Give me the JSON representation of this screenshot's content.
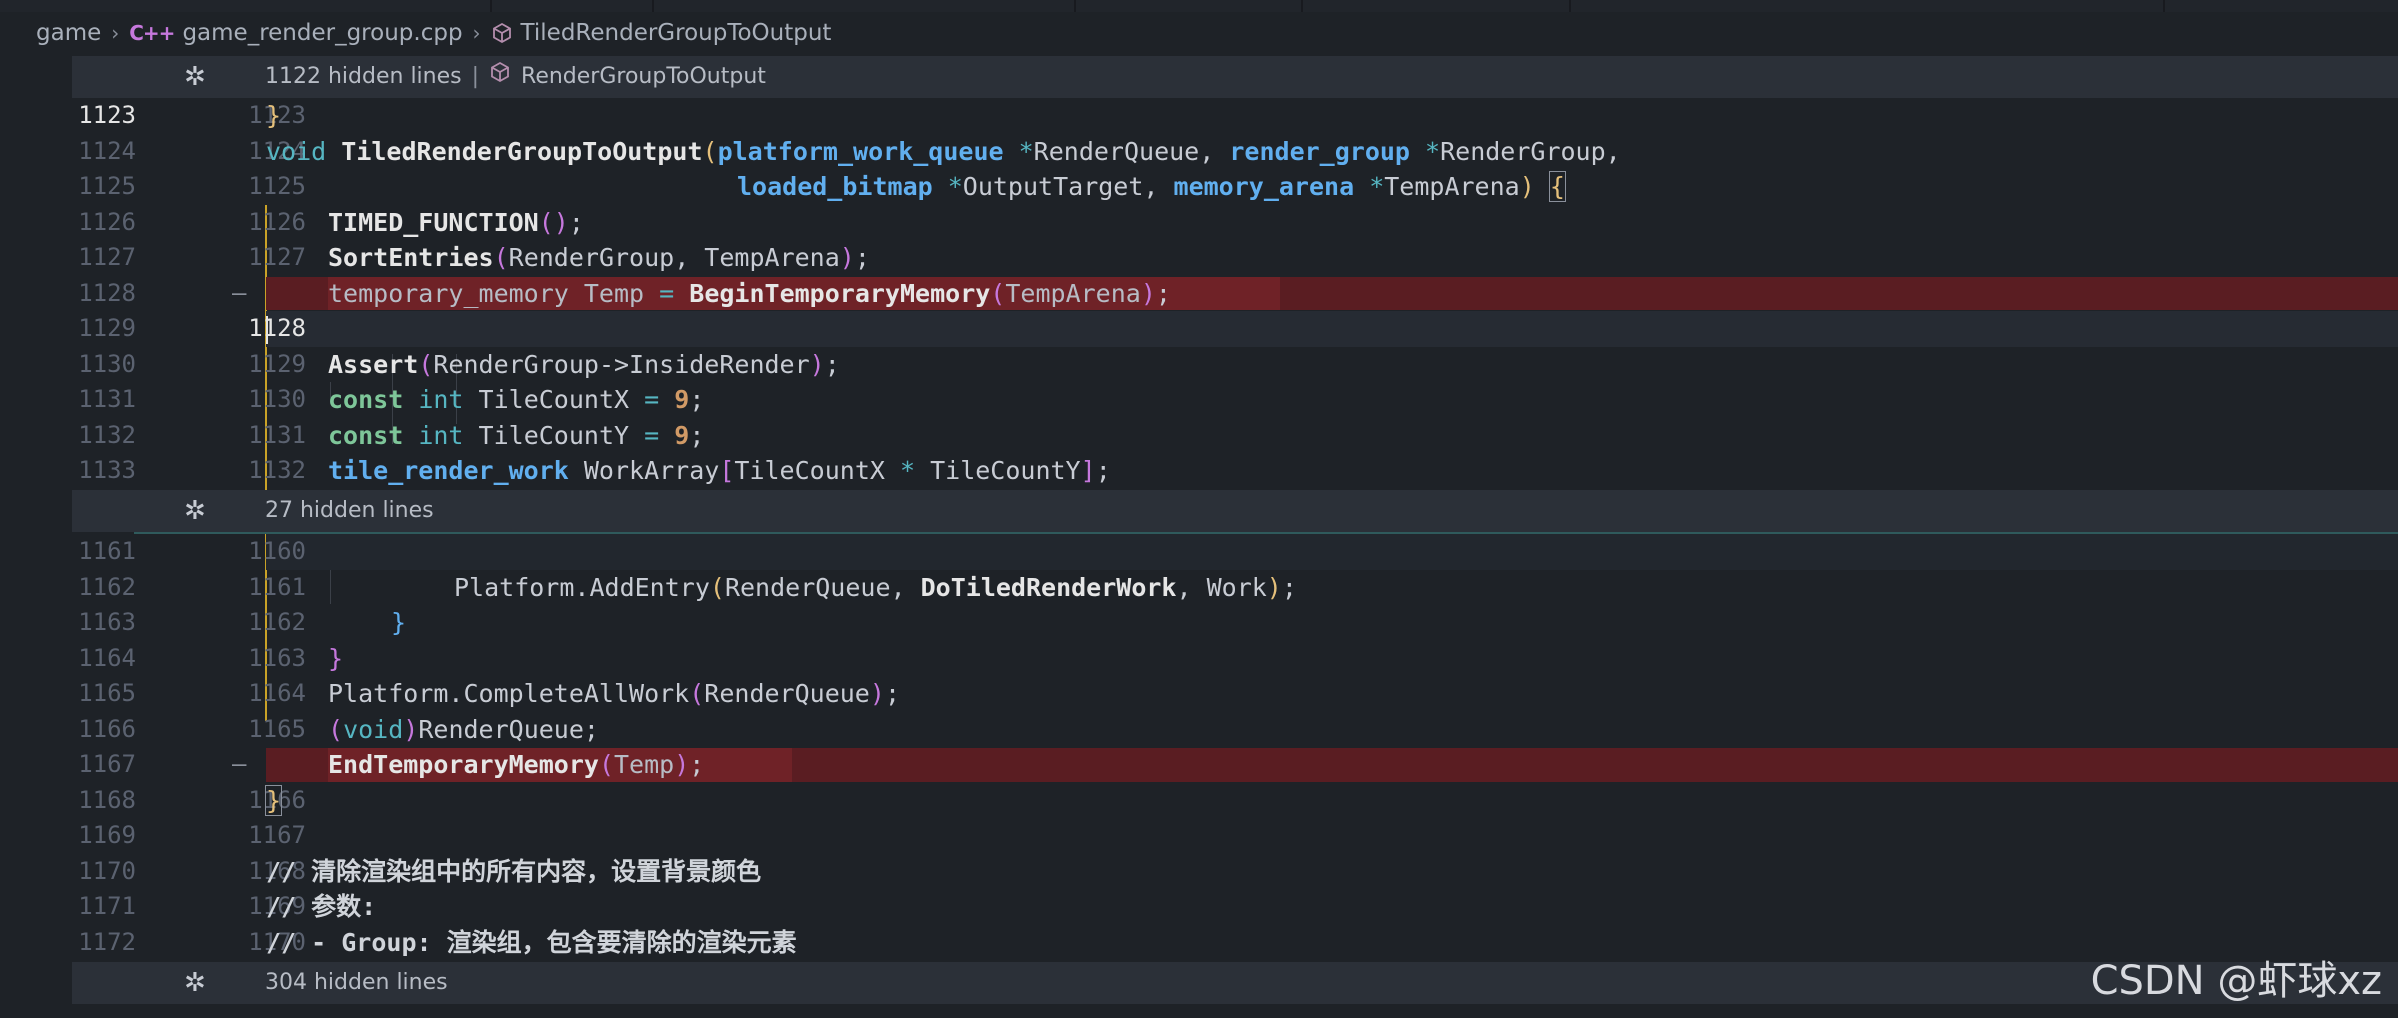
{
  "breadcrumb": {
    "folder": "game",
    "file": "game_render_group.cpp",
    "file_icon_text": "C++",
    "symbol": "TiledRenderGroupToOutput"
  },
  "fold_bars": [
    {
      "text": "1122 hidden lines",
      "symbol": "RenderGroupToOutput"
    },
    {
      "text": "27 hidden lines"
    },
    {
      "text": "304 hidden lines"
    }
  ],
  "lines": {
    "l1": {
      "a": "1123",
      "b": "1123"
    },
    "l2": {
      "a": "1124",
      "b": "1124"
    },
    "l3": {
      "a": "1125",
      "b": "1125"
    },
    "l4": {
      "a": "1126",
      "b": "1126"
    },
    "l5": {
      "a": "1127",
      "b": "1127"
    },
    "l6": {
      "a": "1128",
      "b": "",
      "marker": "—"
    },
    "l7": {
      "a": "1129",
      "b": "1128"
    },
    "l8": {
      "a": "1130",
      "b": "1129"
    },
    "l9": {
      "a": "1131",
      "b": "1130"
    },
    "l10": {
      "a": "1132",
      "b": "1131"
    },
    "l11": {
      "a": "1133",
      "b": "1132"
    },
    "l12": {
      "a": "1161",
      "b": "1160"
    },
    "l13": {
      "a": "1162",
      "b": "1161"
    },
    "l14": {
      "a": "1163",
      "b": "1162"
    },
    "l15": {
      "a": "1164",
      "b": "1163"
    },
    "l16": {
      "a": "1165",
      "b": "1164"
    },
    "l17": {
      "a": "1166",
      "b": "1165"
    },
    "l18": {
      "a": "1167",
      "b": "",
      "marker": "—"
    },
    "l19": {
      "a": "1168",
      "b": "1166"
    },
    "l20": {
      "a": "1169",
      "b": "1167"
    },
    "l21": {
      "a": "1170",
      "b": "1168"
    },
    "l22": {
      "a": "1171",
      "b": "1169"
    },
    "l23": {
      "a": "1172",
      "b": "1170"
    }
  },
  "code": {
    "l1": {
      "brace": "}"
    },
    "l2": {
      "void": "void",
      "fn": "TiledRenderGroupToOutput",
      "p1": "(",
      "t1": "platform_work_queue",
      "s1": " *",
      "v1": "RenderQueue",
      "c1": ", ",
      "t2": "render_group",
      "s2": " *",
      "v2": "RenderGroup",
      "c2": ","
    },
    "l3": {
      "t1": "loaded_bitmap",
      "s1": " *",
      "v1": "OutputTarget",
      "c1": ", ",
      "t2": "memory_arena",
      "s2": " *",
      "v2": "TempArena",
      "p2": ")",
      "b": "{"
    },
    "l4": {
      "fn": "TIMED_FUNCTION",
      "p": "()",
      "semi": ";"
    },
    "l5": {
      "fn": "SortEntries",
      "p1": "(",
      "args": "RenderGroup, TempArena",
      "p2": ")",
      "semi": ";"
    },
    "l6": {
      "pre": "temporary_memory Temp ",
      "eq": "=",
      "sp": " ",
      "fn": "BeginTemporaryMemory",
      "p1": "(",
      "arg": "TempArena",
      "p2": ")",
      "semi": ";"
    },
    "l8": {
      "fn": "Assert",
      "p1": "(",
      "arg": "RenderGroup->InsideRender",
      "p2": ")",
      "semi": ";"
    },
    "l9": {
      "kw": "const",
      "ty": "int",
      "id": "TileCountX",
      "eq": "=",
      "num": "9",
      "semi": ";"
    },
    "l10": {
      "kw": "const",
      "ty": "int",
      "id": "TileCountY",
      "eq": "=",
      "num": "9",
      "semi": ";"
    },
    "l11": {
      "ty": "tile_render_work",
      "id": " WorkArray",
      "b1": "[",
      "a": "TileCountX ",
      "op": "*",
      "b": " TileCountY",
      "b2": "]",
      "semi": ";"
    },
    "l13": {
      "pre": "Platform.AddEntry",
      "p1": "(",
      "a": "RenderQueue, ",
      "fn": "DoTiledRenderWork",
      "b": ", Work",
      "p2": ")",
      "semi": ";"
    },
    "l14": {
      "brace": "}"
    },
    "l15": {
      "brace": "}"
    },
    "l16": {
      "pre": "Platform.CompleteAllWork",
      "p1": "(",
      "a": "RenderQueue",
      "p2": ")",
      "semi": ";"
    },
    "l17": {
      "p1": "(",
      "kw": "void",
      "p2": ")",
      "a": "RenderQueue;"
    },
    "l18": {
      "fn": "EndTemporaryMemory",
      "p1": "(",
      "arg": "Temp",
      "p2": ")",
      "semi": ";"
    },
    "l19": {
      "brace": "}"
    },
    "l21": {
      "text": "// 清除渲染组中的所有内容，设置背景颜色"
    },
    "l22": {
      "text": "// 参数:"
    },
    "l23": {
      "text": "// - Group: 渲染组，包含要清除的渲染元素"
    }
  },
  "watermark": "CSDN @虾球xz",
  "colors": {
    "background": "#1e2227",
    "removed_line": "#5a1d22",
    "type": "#61afef",
    "keyword": "#56b6c2",
    "number": "#d19a66",
    "fold_bar": "#2b3038"
  }
}
